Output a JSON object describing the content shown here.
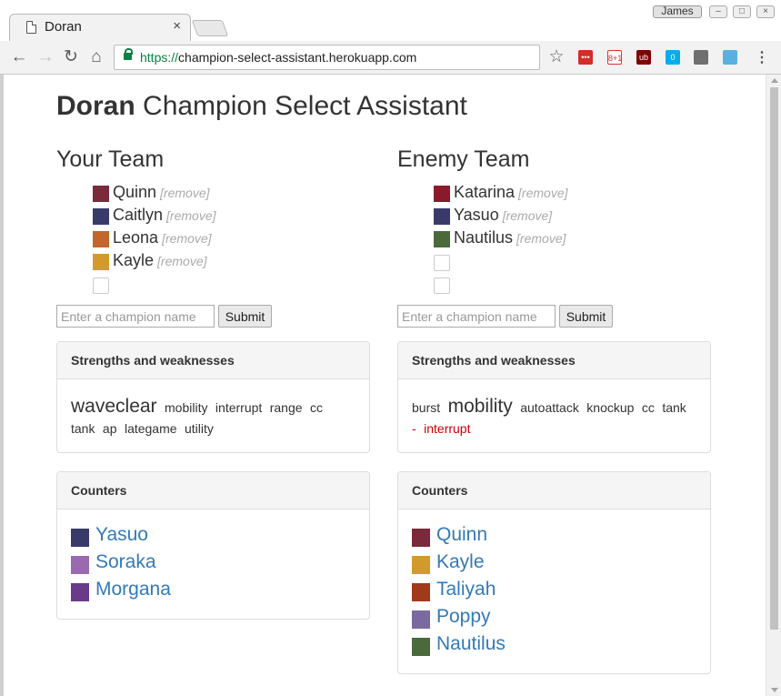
{
  "browser": {
    "tab_title": "Doran",
    "tab_close": "×",
    "user_name": "James",
    "url_scheme": "https://",
    "url_host": "champion-select-assistant.herokuapp.com",
    "nav": {
      "back": "←",
      "forward": "→",
      "reload": "↻",
      "home": "⌂"
    },
    "bookmark_star": "☆",
    "menu": "⋮",
    "extensions": [
      {
        "name": "lastpass-icon",
        "glyph": "•••",
        "color": "#d32d27"
      },
      {
        "name": "google-plus-icon",
        "glyph": "8+1",
        "color": "#ffffff"
      },
      {
        "name": "ublock-icon",
        "glyph": "ub",
        "color": "#800000"
      },
      {
        "name": "ghostery-icon",
        "glyph": "0",
        "color": "#00aef0"
      },
      {
        "name": "cloud-icon",
        "glyph": "",
        "color": "#6f6f6f"
      },
      {
        "name": "circle-extension-icon",
        "glyph": "",
        "color": "#5ab0e0"
      }
    ]
  },
  "page": {
    "title_bold": "Doran",
    "title_rest": " Champion Select Assistant"
  },
  "your_team": {
    "heading": "Your Team",
    "members": [
      {
        "name": "Quinn",
        "remove": "[remove]",
        "portrait_color": "#7a2a3a"
      },
      {
        "name": "Caitlyn",
        "remove": "[remove]",
        "portrait_color": "#3a3a6a"
      },
      {
        "name": "Leona",
        "remove": "[remove]",
        "portrait_color": "#c2662a"
      },
      {
        "name": "Kayle",
        "remove": "[remove]",
        "portrait_color": "#d19a2a"
      }
    ],
    "input_placeholder": "Enter a champion name",
    "submit_label": "Submit",
    "strengths": {
      "heading": "Strengths and weaknesses",
      "tags": [
        {
          "text": "waveclear",
          "size": "big",
          "negative": false
        },
        {
          "text": "mobility",
          "size": "small",
          "negative": false
        },
        {
          "text": "interrupt",
          "size": "small",
          "negative": false
        },
        {
          "text": "range",
          "size": "small",
          "negative": false
        },
        {
          "text": "cc",
          "size": "small",
          "negative": false
        },
        {
          "text": "tank",
          "size": "small",
          "negative": false
        },
        {
          "text": "ap",
          "size": "small",
          "negative": false
        },
        {
          "text": "lategame",
          "size": "small",
          "negative": false
        },
        {
          "text": "utility",
          "size": "small",
          "negative": false
        }
      ]
    },
    "counters": {
      "heading": "Counters",
      "items": [
        {
          "name": "Yasuo",
          "portrait_color": "#3a3a6a"
        },
        {
          "name": "Soraka",
          "portrait_color": "#9a6ab0"
        },
        {
          "name": "Morgana",
          "portrait_color": "#6a3a8a"
        }
      ]
    }
  },
  "enemy_team": {
    "heading": "Enemy Team",
    "members": [
      {
        "name": "Katarina",
        "remove": "[remove]",
        "portrait_color": "#8a1a2a"
      },
      {
        "name": "Yasuo",
        "remove": "[remove]",
        "portrait_color": "#3a3a6a"
      },
      {
        "name": "Nautilus",
        "remove": "[remove]",
        "portrait_color": "#4a6a3a"
      }
    ],
    "input_placeholder": "Enter a champion name",
    "submit_label": "Submit",
    "strengths": {
      "heading": "Strengths and weaknesses",
      "tags": [
        {
          "text": "burst",
          "size": "small",
          "negative": false
        },
        {
          "text": "mobility",
          "size": "big",
          "negative": false
        },
        {
          "text": "autoattack",
          "size": "small",
          "negative": false
        },
        {
          "text": "knockup",
          "size": "small",
          "negative": false
        },
        {
          "text": "cc",
          "size": "small",
          "negative": false
        },
        {
          "text": "tank",
          "size": "small",
          "negative": false
        },
        {
          "text": "-",
          "size": "small",
          "negative": true
        },
        {
          "text": "interrupt",
          "size": "small",
          "negative": true
        }
      ]
    },
    "counters": {
      "heading": "Counters",
      "items": [
        {
          "name": "Quinn",
          "portrait_color": "#7a2a3a"
        },
        {
          "name": "Kayle",
          "portrait_color": "#d19a2a"
        },
        {
          "name": "Taliyah",
          "portrait_color": "#a03a1a"
        },
        {
          "name": "Poppy",
          "portrait_color": "#7a6aa0"
        },
        {
          "name": "Nautilus",
          "portrait_color": "#4a6a3a"
        }
      ]
    }
  }
}
